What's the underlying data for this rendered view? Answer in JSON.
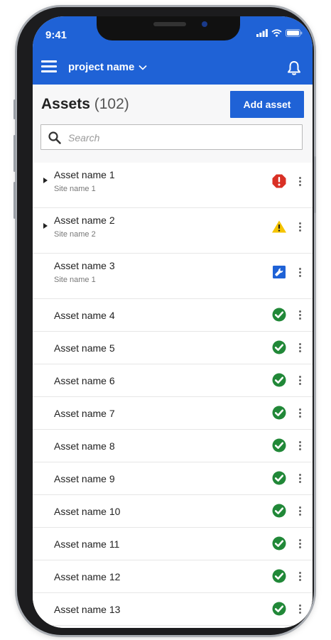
{
  "status_bar": {
    "time": "9:41"
  },
  "app_bar": {
    "project_name": "project name"
  },
  "header": {
    "title": "Assets",
    "count": "(102)",
    "add_button": "Add asset"
  },
  "search": {
    "placeholder": "Search",
    "value": ""
  },
  "assets": [
    {
      "name": "Asset name 1",
      "site": "Site name 1",
      "status": "error",
      "expandable": true
    },
    {
      "name": "Asset name 2",
      "site": "Site name 2",
      "status": "warning",
      "expandable": true
    },
    {
      "name": "Asset name 3",
      "site": "Site name 1",
      "status": "maintenance",
      "expandable": false
    },
    {
      "name": "Asset name 4",
      "status": "ok"
    },
    {
      "name": "Asset name 5",
      "status": "ok"
    },
    {
      "name": "Asset name 6",
      "status": "ok"
    },
    {
      "name": "Asset name 7",
      "status": "ok"
    },
    {
      "name": "Asset name 8",
      "status": "ok"
    },
    {
      "name": "Asset name 9",
      "status": "ok"
    },
    {
      "name": "Asset name 10",
      "status": "ok"
    },
    {
      "name": "Asset name 11",
      "status": "ok"
    },
    {
      "name": "Asset name 12",
      "status": "ok"
    },
    {
      "name": "Asset name 13",
      "status": "ok"
    },
    {
      "name": "",
      "status": "ok"
    }
  ],
  "colors": {
    "brand": "#1f62d6",
    "error": "#d93025",
    "warning": "#f5c400",
    "maintenance": "#1f62d6",
    "ok": "#218838"
  }
}
